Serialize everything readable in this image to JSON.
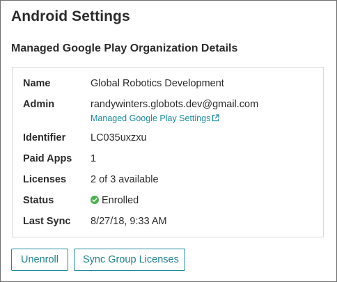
{
  "page": {
    "title": "Android Settings",
    "section_title": "Managed Google Play Organization Details"
  },
  "details": {
    "name": {
      "label": "Name",
      "value": "Global Robotics Development"
    },
    "admin": {
      "label": "Admin",
      "value": "randywinters.globots.dev@gmail.com",
      "link_label": "Managed Google Play Settings",
      "link_icon": "external-link-icon"
    },
    "identifier": {
      "label": "Identifier",
      "value": "LC035uxzxu"
    },
    "paid_apps": {
      "label": "Paid Apps",
      "value": "1"
    },
    "licenses": {
      "label": "Licenses",
      "value": "2 of 3 available"
    },
    "status": {
      "label": "Status",
      "value": "Enrolled",
      "icon": "check-circle-icon",
      "icon_color": "#4caf50"
    },
    "last_sync": {
      "label": "Last Sync",
      "value": "8/27/18, 9:33 AM"
    }
  },
  "actions": {
    "unenroll_label": "Unenroll",
    "sync_label": "Sync Group Licenses"
  },
  "colors": {
    "accent": "#1f8a9a",
    "link": "#1a8a9c",
    "success": "#4caf50"
  }
}
